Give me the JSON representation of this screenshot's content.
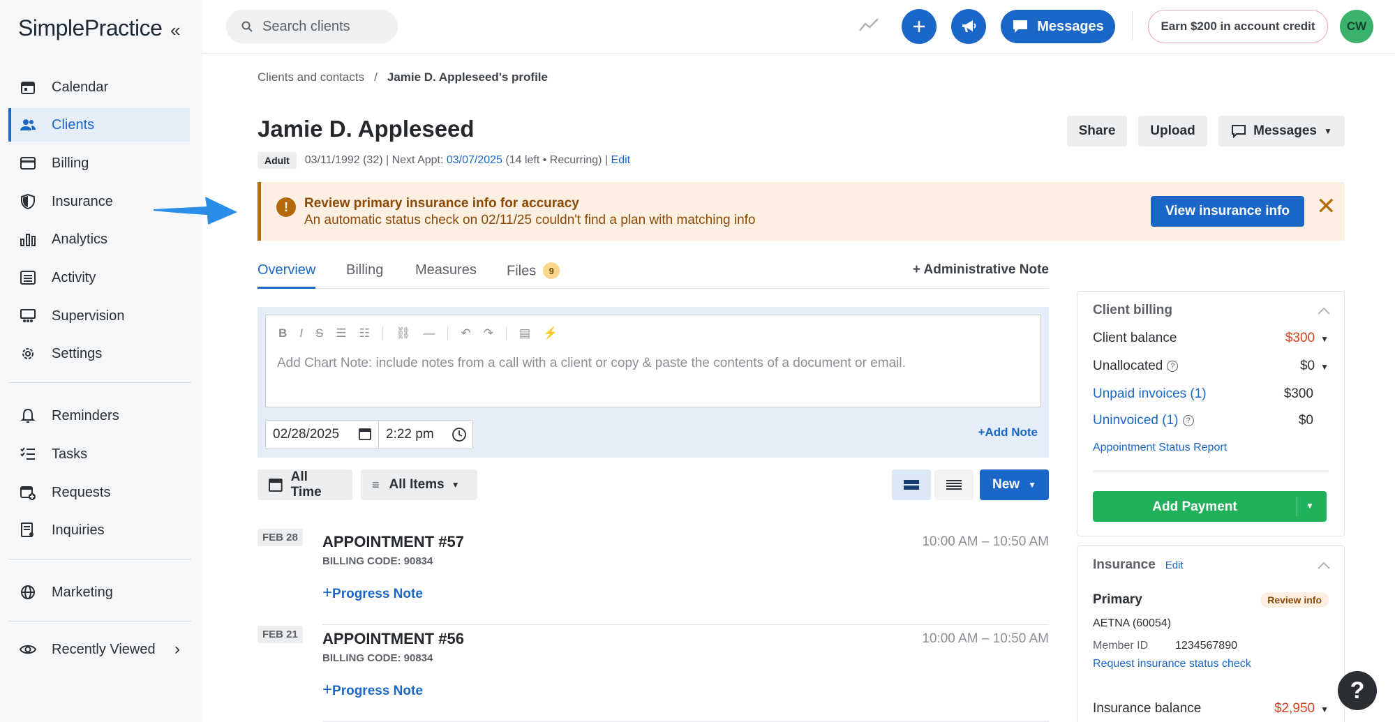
{
  "app": {
    "logo": "SimplePractice",
    "collapse_icon": "double-chevron-left"
  },
  "sidebar": {
    "items": [
      {
        "label": "Calendar",
        "icon": "calendar-icon"
      },
      {
        "label": "Clients",
        "icon": "users-icon",
        "active": true
      },
      {
        "label": "Billing",
        "icon": "card-icon"
      },
      {
        "label": "Insurance",
        "icon": "shield-icon"
      },
      {
        "label": "Analytics",
        "icon": "bar-chart-icon"
      },
      {
        "label": "Activity",
        "icon": "list-icon"
      },
      {
        "label": "Supervision",
        "icon": "supervision-icon"
      },
      {
        "label": "Settings",
        "icon": "gear-icon"
      }
    ],
    "items2": [
      {
        "label": "Reminders",
        "icon": "bell-icon"
      },
      {
        "label": "Tasks",
        "icon": "checklist-icon"
      },
      {
        "label": "Requests",
        "icon": "calendar-plus-icon"
      },
      {
        "label": "Inquiries",
        "icon": "inquiry-icon"
      }
    ],
    "marketing": "Marketing",
    "recently_viewed": "Recently Viewed"
  },
  "topbar": {
    "search_placeholder": "Search clients",
    "messages": "Messages",
    "earn": "Earn $200 in account credit",
    "avatar": "CW"
  },
  "breadcrumb": {
    "parent": "Clients and contacts",
    "sep": "/",
    "current": "Jamie D. Appleseed's profile"
  },
  "client": {
    "name": "Jamie D. Appleseed",
    "type": "Adult",
    "meta_prefix": "03/11/1992 (32) | Next Appt: ",
    "next_appt": "03/07/2025",
    "meta_suffix": " (14 left • Recurring) | ",
    "edit": "Edit"
  },
  "header_buttons": {
    "share": "Share",
    "upload": "Upload",
    "messages": "Messages"
  },
  "alert": {
    "title": "Review primary insurance info for accuracy",
    "body": "An automatic status check on 02/11/25 couldn't find a plan with matching info",
    "action": "View insurance info",
    "accent": "#b56a0a"
  },
  "tabs": [
    {
      "label": "Overview"
    },
    {
      "label": "Billing"
    },
    {
      "label": "Measures"
    },
    {
      "label": "Files",
      "badge": "9"
    }
  ],
  "admin_note": "+ Administrative Note",
  "editor": {
    "placeholder": "Add Chart Note: include notes from a call with a client or copy & paste the contents of a document or email.",
    "date": "02/28/2025",
    "time": "2:22 pm",
    "add_note": "+Add Note"
  },
  "filters": {
    "all_time": "All Time",
    "all_items": "All Items",
    "new": "New"
  },
  "appointments": [
    {
      "date": "FEB 28",
      "title": "APPOINTMENT #57",
      "code": "BILLING CODE: 90834",
      "time": "10:00 AM – 10:50 AM",
      "note": "Progress Note"
    },
    {
      "date": "FEB 21",
      "title": "APPOINTMENT #56",
      "code": "BILLING CODE: 90834",
      "time": "10:00 AM – 10:50 AM",
      "note": "Progress Note"
    }
  ],
  "billing": {
    "title": "Client billing",
    "client_balance_label": "Client balance",
    "client_balance": "$300",
    "unallocated_label": "Unallocated",
    "unallocated": "$0",
    "unpaid_label": "Unpaid invoices (1)",
    "unpaid": "$300",
    "uninvoiced_label": "Uninvoiced (1)",
    "uninvoiced": "$0",
    "report": "Appointment Status Report",
    "add_payment": "Add Payment"
  },
  "insurance": {
    "title": "Insurance",
    "edit": "Edit",
    "primary": "Primary",
    "review": "Review info",
    "payer": "AETNA (60054)",
    "member_label": "Member ID",
    "member_id": "1234567890",
    "request": "Request insurance status check",
    "balance_label": "Insurance balance",
    "balance": "$2,950"
  },
  "help": "?"
}
